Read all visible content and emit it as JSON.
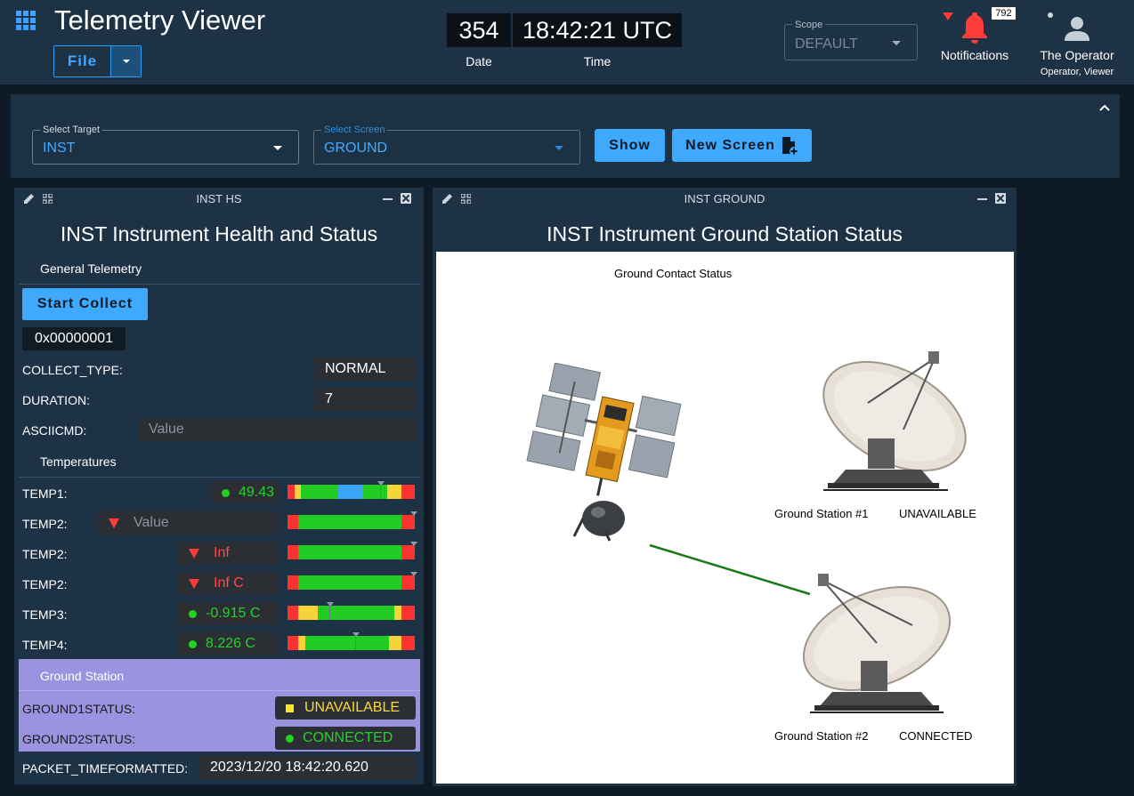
{
  "header": {
    "title": "Telemetry Viewer",
    "file_label": "File",
    "date_value": "354",
    "time_value": "18:42:21 UTC",
    "date_label": "Date",
    "time_label": "Time",
    "scope_label": "Scope",
    "scope_value": "DEFAULT",
    "notifications_count": "792",
    "notifications_label": "Notifications",
    "user_name": "The Operator",
    "user_role": "Operator, Viewer"
  },
  "selector": {
    "target_label": "Select Target",
    "target_value": "INST",
    "screen_label": "Select Screen",
    "screen_value": "GROUND",
    "show_label": "Show",
    "new_screen_label": "New Screen"
  },
  "hs_panel": {
    "header": "INST HS",
    "title": "INST Instrument Health and Status",
    "general_section": "General Telemetry",
    "start_collect": "Start Collect",
    "hex_value": "0x00000001",
    "collect_type_label": "COLLECT_TYPE:",
    "collect_type_value": "NORMAL",
    "duration_label": "DURATION:",
    "duration_value": "7",
    "asciicmd_label": "ASCIICMD:",
    "asciicmd_placeholder": "Value",
    "temps_section": "Temperatures",
    "temps": [
      {
        "label": "TEMP1:",
        "value": "49.43"
      },
      {
        "label": "TEMP2:",
        "value": "Value"
      },
      {
        "label": "TEMP2:",
        "value": "Inf"
      },
      {
        "label": "TEMP2:",
        "value": "Inf C"
      },
      {
        "label": "TEMP3:",
        "value": "-0.915 C"
      },
      {
        "label": "TEMP4:",
        "value": "8.226 C"
      }
    ],
    "ground_section": "Ground Station",
    "ground1_label": "GROUND1STATUS:",
    "ground1_value": "UNAVAILABLE",
    "ground2_label": "GROUND2STATUS:",
    "ground2_value": "CONNECTED",
    "packet_time_label": "PACKET_TIMEFORMATTED:",
    "packet_time_value": "2023/12/20 18:42:20.620"
  },
  "gs_panel": {
    "header": "INST GROUND",
    "title": "INST Instrument Ground Station Status",
    "contact_label": "Ground Contact Status",
    "station1_label": "Ground Station #1",
    "station1_status": "UNAVAILABLE",
    "station2_label": "Ground Station #2",
    "station2_status": "CONNECTED"
  },
  "colors": {
    "accent": "#3ea9fd",
    "background": "#0e1a26",
    "panel": "#1e3246",
    "ok": "#23d22a",
    "warning": "#f9d93a",
    "error": "#ff4a4a",
    "ground_section": "#9b92e0",
    "link_line": "#1a7a1a"
  }
}
